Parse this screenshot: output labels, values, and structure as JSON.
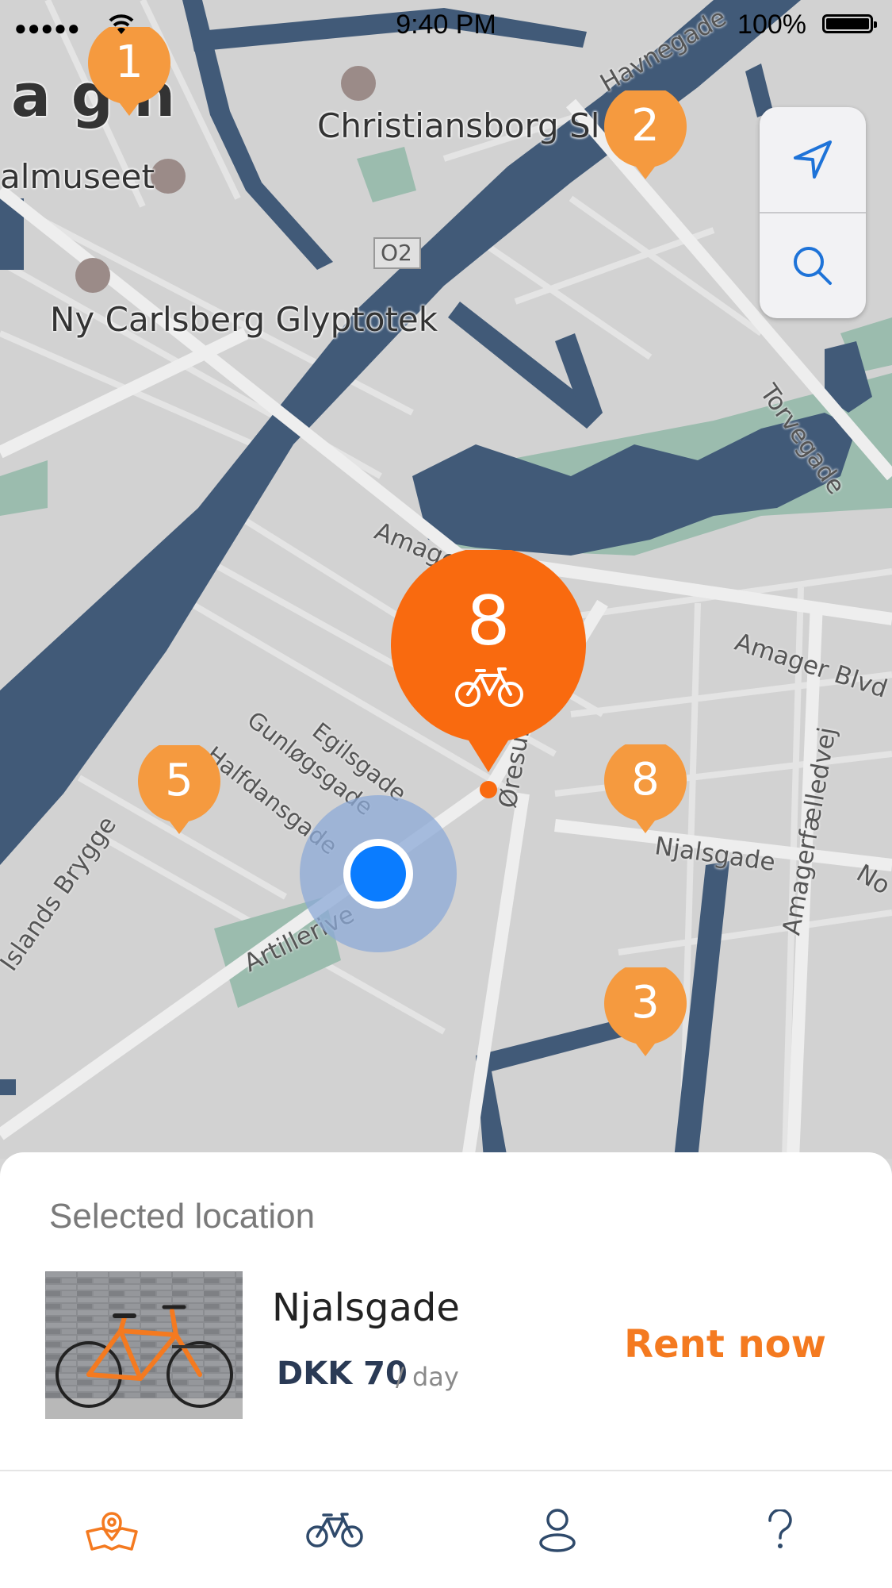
{
  "status_bar": {
    "signal": "●●●●●",
    "time": "9:40 PM",
    "battery": "100%"
  },
  "map": {
    "labels": {
      "partial_city": "a g  n",
      "museum_partial": "almuseet",
      "christiansborg": "Christiansborg Sl",
      "glyptotek": "Ny Carlsberg Glyptotek",
      "route_shield": "O2",
      "havnegade": "Havnegade",
      "torvegade": "Torvegade",
      "amager_blvd_1": "Amager Blvd",
      "amager_blvd_2": "Amager Blvd",
      "oresunds_blvd": "Øresunds Blvd.",
      "amagerfaelledvej": "Amagerfælledvej",
      "egilsgade": "Egilsgade",
      "gunlogsgade": "Gunløgsgade",
      "halfdansgade": "Halfdansgade",
      "artillerivej": "Artillerive",
      "islands_brygge": "Islands Brygge",
      "njalsgade": "Njalsgade",
      "no_partial": "No"
    },
    "markers": [
      {
        "id": "marker-1",
        "count": "1"
      },
      {
        "id": "marker-2",
        "count": "2"
      },
      {
        "id": "marker-5",
        "count": "5"
      },
      {
        "id": "marker-8",
        "count": "8"
      },
      {
        "id": "marker-3",
        "count": "3"
      }
    ],
    "selected_marker": {
      "count": "8",
      "icon": "bike-icon"
    },
    "colors": {
      "water": "#415a78",
      "park": "#9bbcae",
      "road": "#e6e6e6",
      "marker": "#f59a3f",
      "selected": "#f96a0f",
      "user_location": "#0a7cff"
    }
  },
  "map_controls": {
    "locate_icon": "navigation-arrow-icon",
    "search_icon": "search-icon"
  },
  "selected_location": {
    "section_label": "Selected location",
    "name": "Njalsgade",
    "price": "DKK 70",
    "unit": "/ day",
    "action": "Rent now"
  },
  "tabbar": {
    "tabs": [
      {
        "name": "map-tab",
        "icon": "map-pin-icon",
        "active": true
      },
      {
        "name": "bikes-tab",
        "icon": "bike-icon",
        "active": false
      },
      {
        "name": "profile-tab",
        "icon": "user-icon",
        "active": false
      },
      {
        "name": "help-tab",
        "icon": "question-icon",
        "active": false
      }
    ],
    "active_color": "#f47a20",
    "inactive_color": "#2f4a6b"
  }
}
